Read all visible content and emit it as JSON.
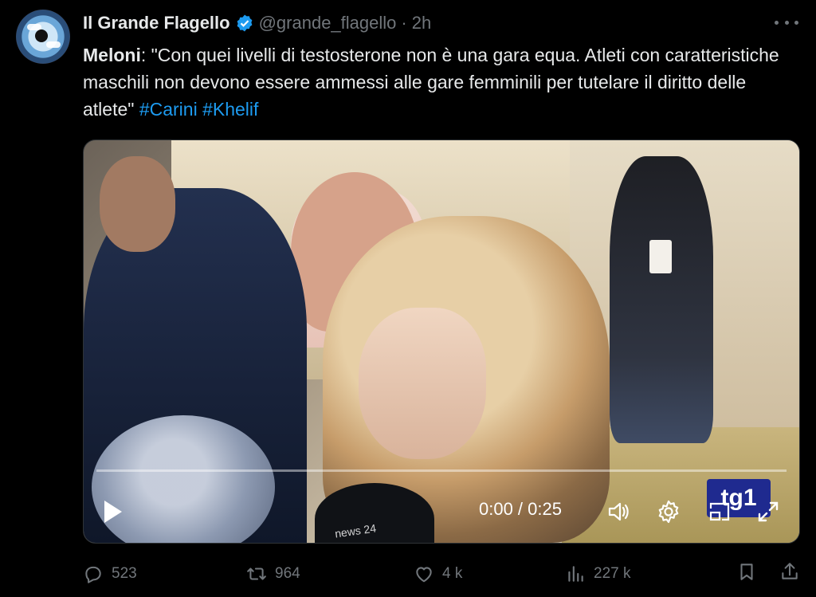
{
  "tweet": {
    "author_name": "Il Grande Flagello",
    "handle": "@grande_flagello",
    "separator": "·",
    "time": "2h",
    "text_bold": "Meloni",
    "text_body": ": \"Con quei livelli di testosterone non è una gara equa. Atleti con caratteristiche maschili non devono essere ammessi alle gare femminili per tutelare il diritto delle atlete\" ",
    "hashtags": [
      "#Carini",
      "#Khelif"
    ],
    "video": {
      "current_time": "0:00",
      "duration": "0:25",
      "timecode": "0:00 / 0:25",
      "progress": 0,
      "logo_text": "tg1",
      "mic_label": "news 24"
    },
    "stats": {
      "replies": "523",
      "retweets": "964",
      "likes": "4 k",
      "views": "227 k"
    }
  },
  "icons": {
    "verified": "verified-badge-icon",
    "more": "more-dots-icon",
    "play": "play-icon",
    "volume": "volume-icon",
    "settings": "gear-icon",
    "pip": "picture-in-picture-icon",
    "fullscreen": "fullscreen-icon",
    "reply": "reply-icon",
    "retweet": "retweet-icon",
    "like": "heart-icon",
    "views": "views-icon",
    "bookmark": "bookmark-icon",
    "share": "share-icon"
  },
  "colors": {
    "background": "#000000",
    "text_primary": "#e7e9ea",
    "text_secondary": "#71767b",
    "accent": "#1d9bf0"
  }
}
